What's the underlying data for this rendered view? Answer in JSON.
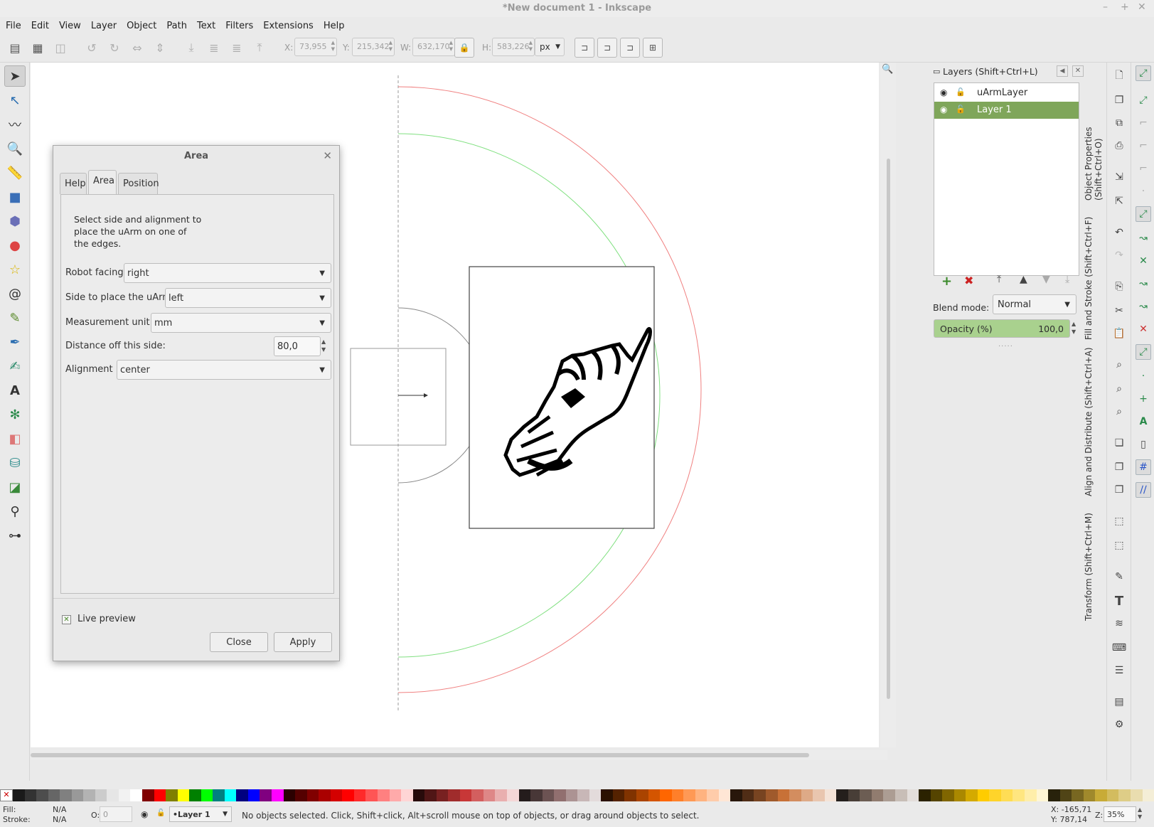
{
  "window": {
    "title": "*New document 1 - Inkscape",
    "controls": [
      "–",
      "+",
      "✕"
    ]
  },
  "menu": [
    "File",
    "Edit",
    "View",
    "Layer",
    "Object",
    "Path",
    "Text",
    "Filters",
    "Extensions",
    "Help"
  ],
  "toolbar": {
    "x_label": "X:",
    "x_value": "73,955",
    "y_label": "Y:",
    "y_value": "215,342",
    "w_label": "W:",
    "w_value": "632,170",
    "h_label": "H:",
    "h_value": "583,226",
    "unit": "px"
  },
  "dialog": {
    "title": "Area",
    "close_glyph": "✕",
    "tabs": [
      "Help",
      "Area",
      "Position"
    ],
    "active_tab": "Area",
    "description": "Select side and alignment to place the uArm on one of the edges.",
    "robot_facing_label": "Robot facing",
    "robot_facing_value": "right",
    "side_label": "Side to place the uArm",
    "side_value": "left",
    "unit_label": "Measurement unit:",
    "unit_value": "mm",
    "distance_label": "Distance off this side:",
    "distance_value": "80,0",
    "alignment_label": "Alignment",
    "alignment_value": "center",
    "live_preview_label": "Live preview",
    "live_preview_checked": true,
    "close_label": "Close",
    "apply_label": "Apply"
  },
  "layers": {
    "title": "Layers (Shift+Ctrl+L)",
    "items": [
      {
        "name": "uArmLayer",
        "selected": false
      },
      {
        "name": "Layer 1",
        "selected": true
      }
    ],
    "blend_label": "Blend mode:",
    "blend_value": "Normal",
    "opacity_label": "Opacity (%)",
    "opacity_value": "100,0"
  },
  "docked_tabs": [
    "Object Properties (Shift+Ctrl+O)",
    "Fill and Stroke (Shift+Ctrl+F)",
    "Align and Distribute (Shift+Ctrl+A)",
    "Transform (Shift+Ctrl+M)"
  ],
  "palette": [
    "#1a1a1a",
    "#333333",
    "#4d4d4d",
    "#666666",
    "#808080",
    "#999999",
    "#b3b3b3",
    "#cccccc",
    "#e6e6e6",
    "#f2f2f2",
    "#ffffff",
    "#800000",
    "#ff0000",
    "#808000",
    "#ffff00",
    "#008000",
    "#00ff00",
    "#008080",
    "#00ffff",
    "#000080",
    "#0000ff",
    "#800080",
    "#ff00ff",
    "#2b0000",
    "#550000",
    "#800000",
    "#aa0000",
    "#d40000",
    "#ff0000",
    "#ff2a2a",
    "#ff5555",
    "#ff8080",
    "#ffaaaa",
    "#ffd5d5",
    "#280b0b",
    "#501616",
    "#782121",
    "#a02c2c",
    "#c83737",
    "#d35f5f",
    "#de8787",
    "#e9afaf",
    "#f4d7d7",
    "#241c1c",
    "#483737",
    "#6c5353",
    "#916f6f",
    "#ac9393",
    "#c8b7b7",
    "#e3dbdb",
    "#2b1100",
    "#552200",
    "#803300",
    "#aa4400",
    "#d45500",
    "#ff6600",
    "#ff7f2a",
    "#ff9955",
    "#ffb380",
    "#ffccaa",
    "#ffe6d5",
    "#28170b",
    "#502d16",
    "#784421",
    "#a05a2c",
    "#c87137",
    "#d38d5f",
    "#deaa87",
    "#e9c6af",
    "#f4e3d7",
    "#241f1c",
    "#483e37",
    "#6c5d53",
    "#917c6f",
    "#ac9d93",
    "#c8beb7",
    "#e3dedb",
    "#2b2200",
    "#554400",
    "#806600",
    "#aa8800",
    "#d4aa00",
    "#ffcc00",
    "#ffd42a",
    "#ffdd55",
    "#ffe680",
    "#ffeeaa",
    "#fff6d5",
    "#28220b",
    "#504416",
    "#786721",
    "#a0892c",
    "#c8ab37",
    "#d3bc5f",
    "#decd87",
    "#e9ddaf",
    "#f4eed7"
  ],
  "status": {
    "fill_label": "Fill:",
    "fill_value": "N/A",
    "stroke_label": "Stroke:",
    "stroke_value": "N/A",
    "opacity_label": "O:",
    "opacity_value": "0",
    "layer": "•Layer 1",
    "message": "No objects selected. Click, Shift+click, Alt+scroll mouse on top of objects, or drag around objects to select.",
    "cursor_x": "X: -165,71",
    "cursor_y": "Y: 787,14",
    "zoom_label": "Z:",
    "zoom_value": "35%"
  },
  "icons": {
    "toolbox": [
      "selector-icon",
      "node-icon",
      "tweak-icon",
      "zoom-icon",
      "measure-icon",
      "rect-icon",
      "3dbox-icon",
      "ellipse-icon",
      "star-icon",
      "spiral-icon",
      "pencil-icon",
      "pen-icon",
      "calligraphy-icon",
      "text-icon",
      "spray-icon",
      "eraser-icon",
      "bucket-icon",
      "gradient-icon",
      "dropper-icon",
      "connector-icon"
    ]
  }
}
